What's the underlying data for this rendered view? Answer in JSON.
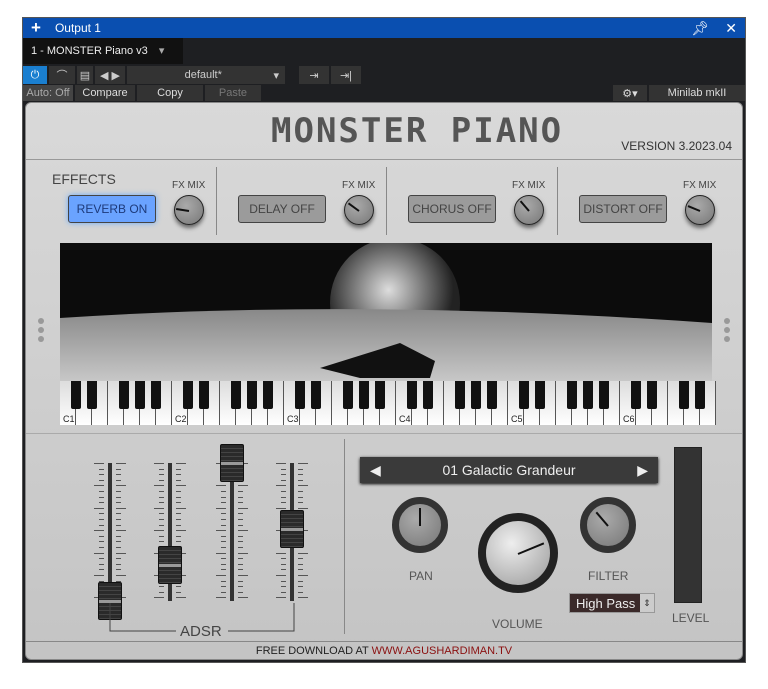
{
  "window": {
    "title": "Output 1",
    "instrument": "1 - MONSTER Piano v3",
    "preset_menu": "default*",
    "auto": "Auto: Off",
    "compare": "Compare",
    "copy": "Copy",
    "paste": "Paste",
    "controller": "Minilab mkII"
  },
  "plugin": {
    "logo": "MONSTER PIANO",
    "version": "VERSION 3.2023.04",
    "effects_label": "EFFECTS",
    "effects": [
      {
        "label": "REVERB ON",
        "on": true,
        "mix_label": "FX MIX",
        "mix": 0.2
      },
      {
        "label": "DELAY OFF",
        "on": false,
        "mix_label": "FX MIX",
        "mix": 0.3
      },
      {
        "label": "CHORUS OFF",
        "on": false,
        "mix_label": "FX MIX",
        "mix": 0.35
      },
      {
        "label": "DISTORT OFF",
        "on": false,
        "mix_label": "FX MIX",
        "mix": 0.25
      }
    ],
    "octaves": [
      "C1",
      "C2",
      "C3",
      "C4",
      "C5",
      "C6"
    ],
    "adsr_label": "ADSR",
    "adsr": {
      "attack": 0.0,
      "decay": 0.26,
      "sustain": 1.0,
      "release": 0.52
    },
    "preset": "01 Galactic Grandeur",
    "pan_label": "PAN",
    "pan": 0.5,
    "volume_label": "VOLUME",
    "volume": 0.75,
    "filter_label": "FILTER",
    "filter": 0.35,
    "filter_type": "High Pass",
    "level_label": "LEVEL",
    "footer_prefix": "FREE DOWNLOAD AT",
    "footer_link": "WWW.AGUSHARDIMAN.TV"
  },
  "colors": {
    "titlebar": "#0a4fb0",
    "reverb_on": "#6aa3ff",
    "link": "#8b1010"
  }
}
